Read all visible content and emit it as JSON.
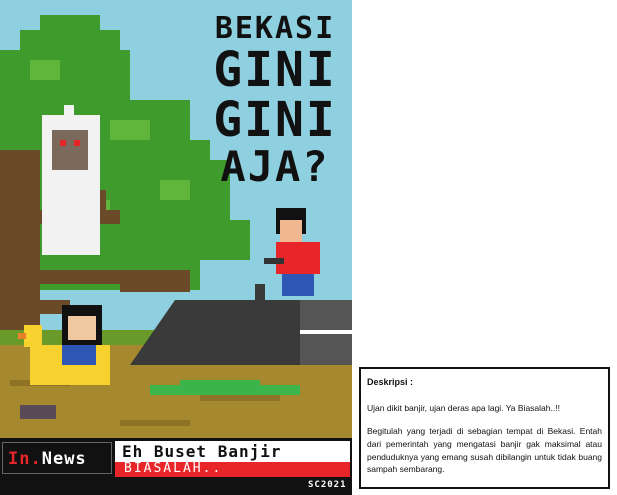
{
  "poster": {
    "title_line1": "BEKASI",
    "title_line2": "GINI",
    "title_line3": "GINI",
    "title_line4": "AJA?",
    "brand_part1": "In.",
    "brand_part2": "News",
    "headline": "Eh Buset Banjir",
    "subheadline": "BIASALAH..",
    "code": "SC2021"
  },
  "description": {
    "label": "Deskripsi :",
    "paragraph1": "Ujan dikit banjir, ujan deras apa lagi. Ya Biasalah..!!",
    "paragraph2": "Begitulah yang terjadi di sebagian tempat di Bekasi. Entah dari pemerintah yang mengatasi banjir gak maksimal atau penduduknya yang emang susah dibilangin untuk tidak buang sampah sembarang."
  },
  "colors": {
    "sky": "#8ecfe0",
    "tree": "#3f9b2b",
    "water": "#a6882f",
    "accent_red": "#e8262a"
  }
}
